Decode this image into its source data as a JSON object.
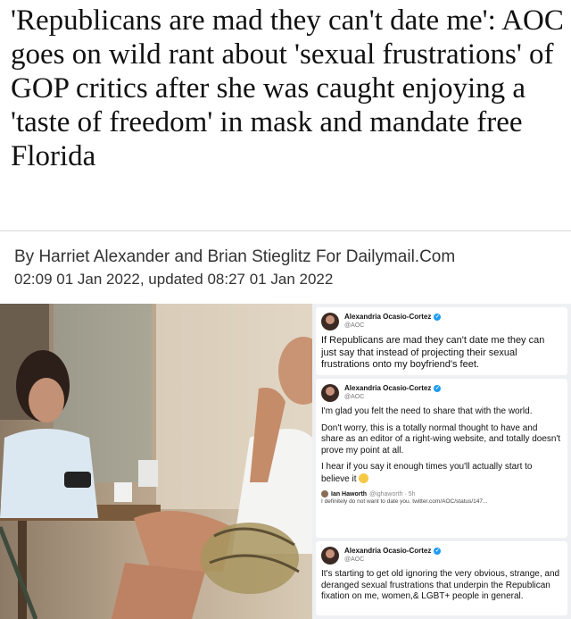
{
  "article": {
    "headline": "'Republicans are mad they can't date me': AOC goes on wild rant about 'sexual frustrations' of GOP critics after she was caught enjoying a 'taste of freedom' in mask and mandate free Florida",
    "byline": "By Harriet Alexander and Brian Stieglitz For Dailymail.Com",
    "dateline": "02:09 01 Jan 2022, updated 08:27 01 Jan 2022"
  },
  "tweets": {
    "tweet1": {
      "name": "Alexandria Ocasio-Cortez",
      "handle": "@AOC",
      "text": "If Republicans are mad they can't date me they can just say that instead of projecting their sexual frustrations onto my boyfriend's feet."
    },
    "tweet2": {
      "name": "Alexandria Ocasio-Cortez",
      "handle": "@AOC",
      "p1": "I'm glad you felt the need to share that with the world.",
      "p2": "Don't worry, this is a totally normal thought to have and share as an editor of a right-wing website, and totally doesn't prove my point at all.",
      "p3": "I hear if you say it enough times you'll actually start to believe it",
      "quote_name": "Ian Haworth",
      "quote_handle": "@ighaworth · 5h",
      "quote_text": "I definitely do not want to date you. twitter.com/AOC/status/147..."
    },
    "tweet3": {
      "name": "Alexandria Ocasio-Cortez",
      "handle": "@AOC",
      "text": "It's starting to get old ignoring the very obvious, strange, and deranged sexual frustrations that underpin the Republican fixation on me, women,& LGBT+ people in general."
    }
  },
  "icons": {
    "verified": "verified-badge-icon",
    "emoji": "grimacing-face-emoji"
  }
}
